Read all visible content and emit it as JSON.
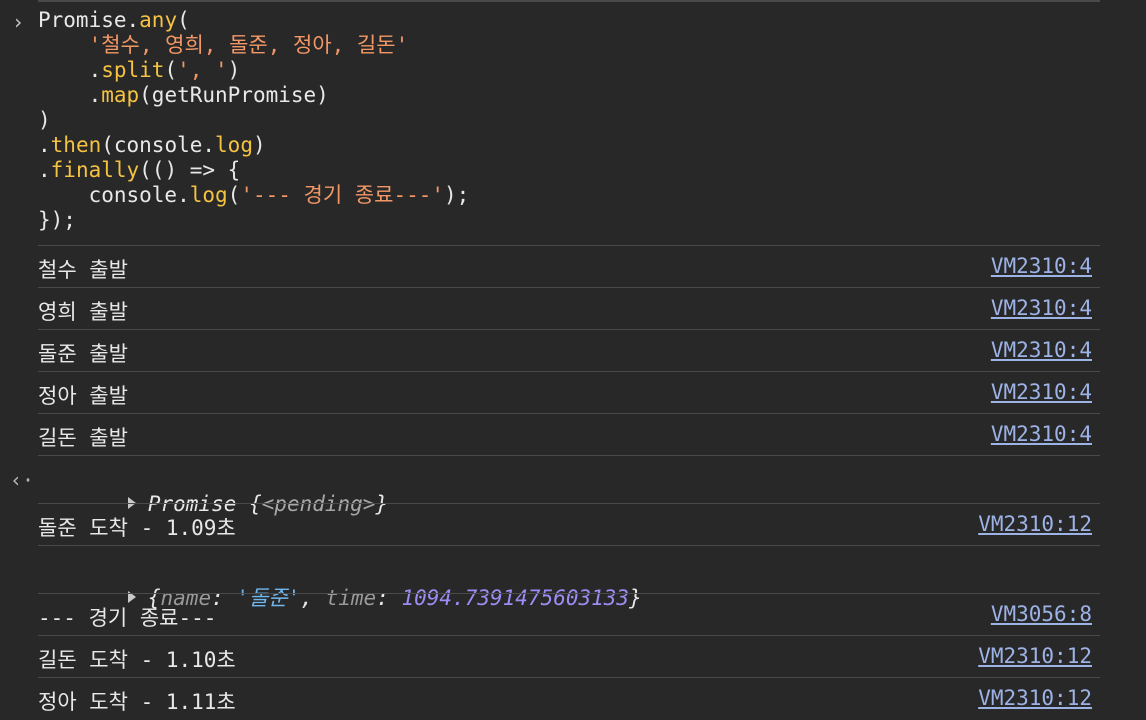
{
  "input": {
    "lines": [
      [
        {
          "t": "Promise.",
          "c": "c-default"
        },
        {
          "t": "any",
          "c": "c-method"
        },
        {
          "t": "(",
          "c": "c-punc"
        }
      ],
      [
        {
          "t": "    ",
          "c": "c-default"
        },
        {
          "t": "'철수, 영희, 돌준, 정아, 길돈'",
          "c": "c-string"
        }
      ],
      [
        {
          "t": "    .",
          "c": "c-default"
        },
        {
          "t": "split",
          "c": "c-method"
        },
        {
          "t": "(",
          "c": "c-punc"
        },
        {
          "t": "', '",
          "c": "c-string"
        },
        {
          "t": ")",
          "c": "c-punc"
        }
      ],
      [
        {
          "t": "    .",
          "c": "c-default"
        },
        {
          "t": "map",
          "c": "c-method"
        },
        {
          "t": "(getRunPromise)",
          "c": "c-punc"
        }
      ],
      [
        {
          "t": ")",
          "c": "c-punc"
        }
      ],
      [
        {
          "t": ".",
          "c": "c-default"
        },
        {
          "t": "then",
          "c": "c-method"
        },
        {
          "t": "(console.",
          "c": "c-punc"
        },
        {
          "t": "log",
          "c": "c-method"
        },
        {
          "t": ")",
          "c": "c-punc"
        }
      ],
      [
        {
          "t": ".",
          "c": "c-default"
        },
        {
          "t": "finally",
          "c": "c-method"
        },
        {
          "t": "(() => {",
          "c": "c-punc"
        }
      ],
      [
        {
          "t": "    console.",
          "c": "c-default"
        },
        {
          "t": "log",
          "c": "c-method"
        },
        {
          "t": "(",
          "c": "c-punc"
        },
        {
          "t": "'--- 경기 종료---'",
          "c": "c-string"
        },
        {
          "t": ");",
          "c": "c-punc"
        }
      ],
      [
        {
          "t": "});",
          "c": "c-punc"
        }
      ]
    ]
  },
  "logs": [
    {
      "message": "철수 출발",
      "source": "VM2310:4"
    },
    {
      "message": "영희 출발",
      "source": "VM2310:4"
    },
    {
      "message": "돌준 출발",
      "source": "VM2310:4"
    },
    {
      "message": "정아 출발",
      "source": "VM2310:4"
    },
    {
      "message": "길돈 출발",
      "source": "VM2310:4"
    }
  ],
  "result": {
    "prefix": "Promise {",
    "state": "<pending>",
    "suffix": "}"
  },
  "logs2": [
    {
      "message": "돌준 도착 - 1.09초",
      "source": "VM2310:12"
    }
  ],
  "object_preview": {
    "open": "{",
    "key1": "name",
    "colon1": ": ",
    "val1": "'돌준'",
    "comma": ", ",
    "key2": "time",
    "colon2": ": ",
    "val2": "1094.7391475603133",
    "close": "}"
  },
  "logs3": [
    {
      "message": "--- 경기 종료---",
      "source": "VM3056:8"
    },
    {
      "message": "길돈 도착 - 1.10초",
      "source": "VM2310:12"
    },
    {
      "message": "정아 도착 - 1.11초",
      "source": "VM2310:12"
    }
  ],
  "icons": {
    "prompt": "chevron-right-icon",
    "result": "return-arrow-icon",
    "expand": "expand-triangle-icon"
  }
}
